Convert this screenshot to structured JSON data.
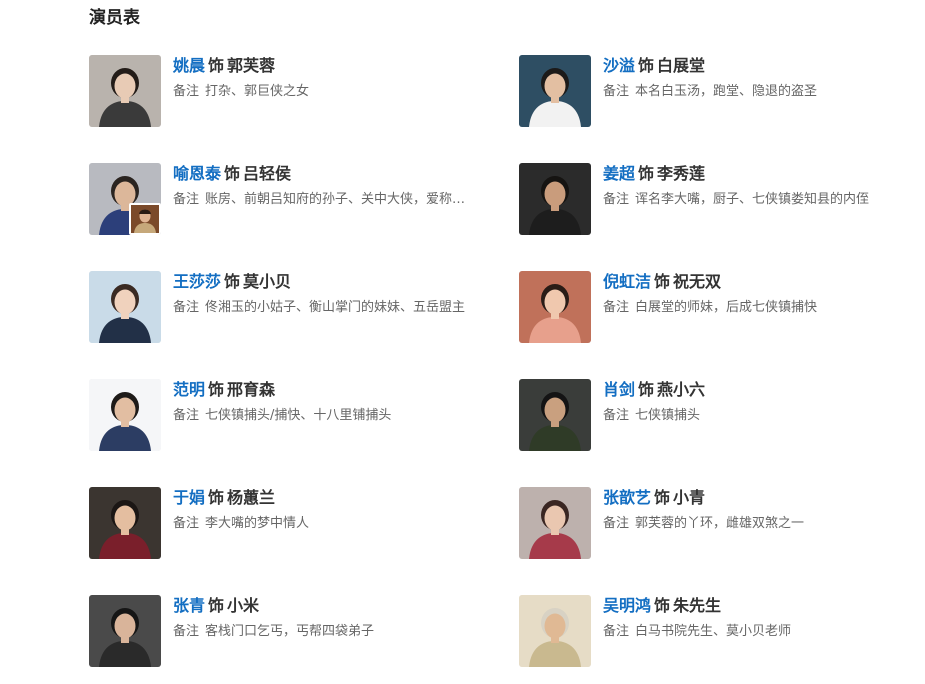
{
  "section": {
    "title": "演员表"
  },
  "cast": [
    {
      "actor": "姚晨",
      "role_word": "饰",
      "role": "郭芙蓉",
      "note_label": "备注",
      "note": "打杂、郭巨侠之女",
      "photo_icon": "actor-photo-icon",
      "colors": {
        "bg": "#b9b3ad",
        "face": "#e8cbb5",
        "hair": "#231c18",
        "body": "#3a3a3a"
      }
    },
    {
      "actor": "沙溢",
      "role_word": "饰",
      "role": "白展堂",
      "note_label": "备注",
      "note": "本名白玉汤，跑堂、隐退的盗圣",
      "photo_icon": "actor-photo-icon",
      "colors": {
        "bg": "#2e4e63",
        "face": "#e3bfa2",
        "hair": "#1c1a19",
        "body": "#f2f2f2"
      }
    },
    {
      "actor": "喻恩泰",
      "role_word": "饰",
      "role": "吕轻侯",
      "note_label": "备注",
      "note": "账房、前朝吕知府的孙子、关中大侠，爱称…",
      "photo_icon": "actor-photo-icon",
      "colors": {
        "bg": "#b8bac0",
        "face": "#dcb79a",
        "hair": "#2a2420",
        "body": "#2c3f7a"
      },
      "has_sub_photo": true
    },
    {
      "actor": "姜超",
      "role_word": "饰",
      "role": "李秀莲",
      "note_label": "备注",
      "note": "诨名李大嘴，厨子、七侠镇娄知县的内侄",
      "photo_icon": "actor-photo-icon",
      "colors": {
        "bg": "#2b2b2b",
        "face": "#c99c7c",
        "hair": "#161412",
        "body": "#1d1d1d"
      }
    },
    {
      "actor": "王莎莎",
      "role_word": "饰",
      "role": "莫小贝",
      "note_label": "备注",
      "note": "佟湘玉的小姑子、衡山掌门的妹妹、五岳盟主",
      "photo_icon": "actor-photo-icon",
      "colors": {
        "bg": "#c9dbe8",
        "face": "#f0d2bd",
        "hair": "#3a2a22",
        "body": "#223047"
      }
    },
    {
      "actor": "倪虹洁",
      "role_word": "饰",
      "role": "祝无双",
      "note_label": "备注",
      "note": "白展堂的师妹，后成七侠镇捕快",
      "photo_icon": "actor-photo-icon",
      "colors": {
        "bg": "#c0715a",
        "face": "#f0c8ae",
        "hair": "#2a1c16",
        "body": "#e7a08c"
      }
    },
    {
      "actor": "范明",
      "role_word": "饰",
      "role": "邢育森",
      "note_label": "备注",
      "note": "七侠镇捕头/捕快、十八里铺捕头",
      "photo_icon": "actor-photo-icon",
      "colors": {
        "bg": "#f5f6f8",
        "face": "#e2bea2",
        "hair": "#1e1b19",
        "body": "#2c3d63"
      }
    },
    {
      "actor": "肖剑",
      "role_word": "饰",
      "role": "燕小六",
      "note_label": "备注",
      "note": "七侠镇捕头",
      "photo_icon": "actor-photo-icon",
      "colors": {
        "bg": "#3a3d3a",
        "face": "#c9a07f",
        "hair": "#141414",
        "body": "#2f3b27"
      }
    },
    {
      "actor": "于娟",
      "role_word": "饰",
      "role": "杨蕙兰",
      "note_label": "备注",
      "note": "李大嘴的梦中情人",
      "photo_icon": "actor-photo-icon",
      "colors": {
        "bg": "#3b3530",
        "face": "#e4bea0",
        "hair": "#1b1614",
        "body": "#7a1f2b"
      }
    },
    {
      "actor": "张歆艺",
      "role_word": "饰",
      "role": "小青",
      "note_label": "备注",
      "note": "郭芙蓉的丫环，雌雄双煞之一",
      "photo_icon": "actor-photo-icon",
      "colors": {
        "bg": "#bdb1ad",
        "face": "#eac7b0",
        "hair": "#3a2622",
        "body": "#a63a4a"
      }
    },
    {
      "actor": "张青",
      "role_word": "饰",
      "role": "小米",
      "note_label": "备注",
      "note": "客栈门口乞丐，丐帮四袋弟子",
      "photo_icon": "actor-photo-icon",
      "colors": {
        "bg": "#4a4a4a",
        "face": "#d9b49a",
        "hair": "#161616",
        "body": "#2a2a2a"
      }
    },
    {
      "actor": "吴明鸿",
      "role_word": "饰",
      "role": "朱先生",
      "note_label": "备注",
      "note": "白马书院先生、莫小贝老师",
      "photo_icon": "actor-photo-icon",
      "colors": {
        "bg": "#e6dcc6",
        "face": "#e0b994",
        "hair": "#d8d2c4",
        "body": "#c9b98f"
      }
    }
  ]
}
